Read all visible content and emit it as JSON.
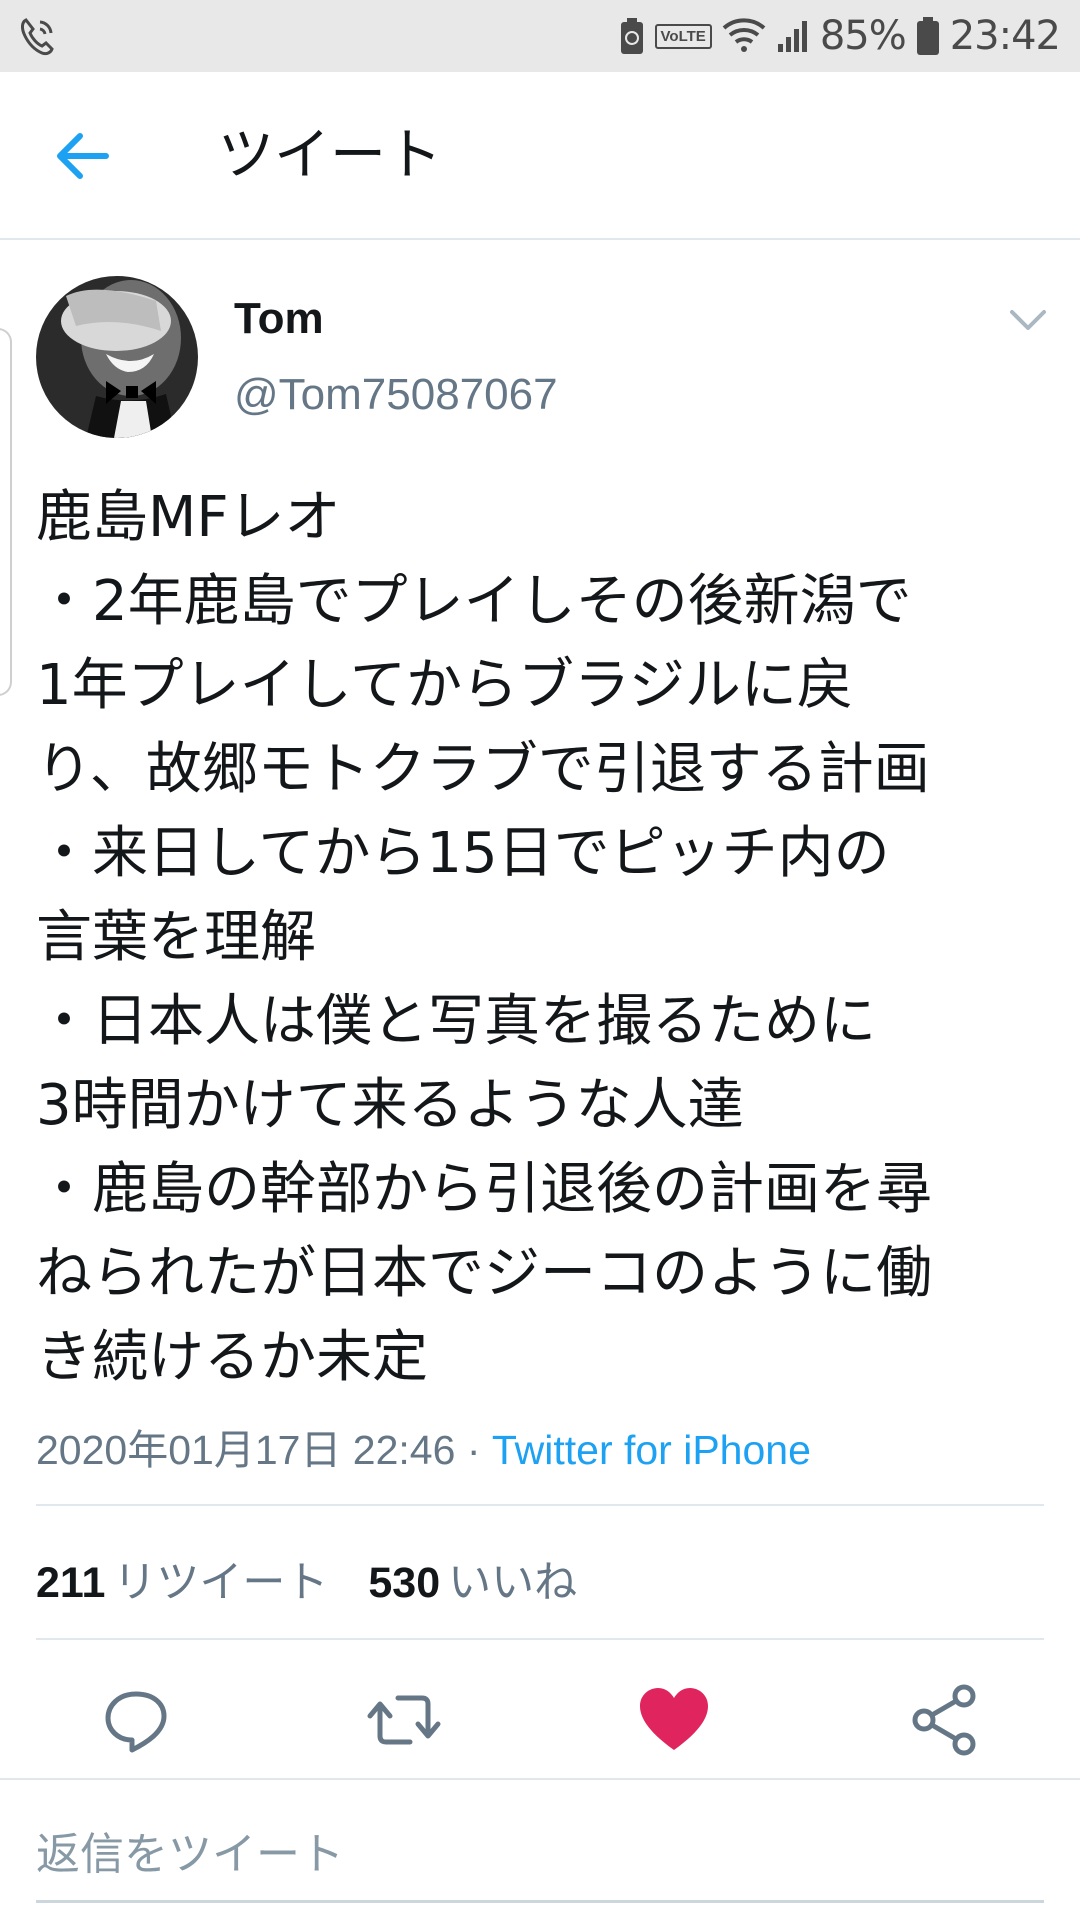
{
  "status_bar": {
    "battery": "85%",
    "time": "23:42",
    "network_badge": "VoLTE"
  },
  "header": {
    "title": "ツイート"
  },
  "tweet": {
    "user_name": "Tom",
    "user_handle": "@Tom75087067",
    "text": "鹿島MFレオ\n・2年鹿島でプレイしその後新潟で\n1年プレイしてからブラジルに戻\nり、故郷モトクラブで引退する計画\n・来日してから15日でピッチ内の\n言葉を理解\n・日本人は僕と写真を撮るために\n3時間かけて来るような人達\n・鹿島の幹部から引退後の計画を尋\nねられたが日本でジーコのように働\nき続けるか未定",
    "timestamp": "2020年01月17日 22:46",
    "separator": " · ",
    "source": "Twitter for iPhone"
  },
  "stats": {
    "retweet_count": "211",
    "retweet_label": "リツイート",
    "like_count": "530",
    "like_label": "いいね"
  },
  "actions": {
    "icons": [
      "reply-icon",
      "retweet-icon",
      "like-icon",
      "share-icon"
    ],
    "like_color": "#e0245e",
    "icon_color": "#657786"
  },
  "reply": {
    "placeholder": "返信をツイート"
  },
  "colors": {
    "accent": "#1da1f2",
    "secondary_text": "#657786",
    "divider": "#e1e8ed"
  }
}
